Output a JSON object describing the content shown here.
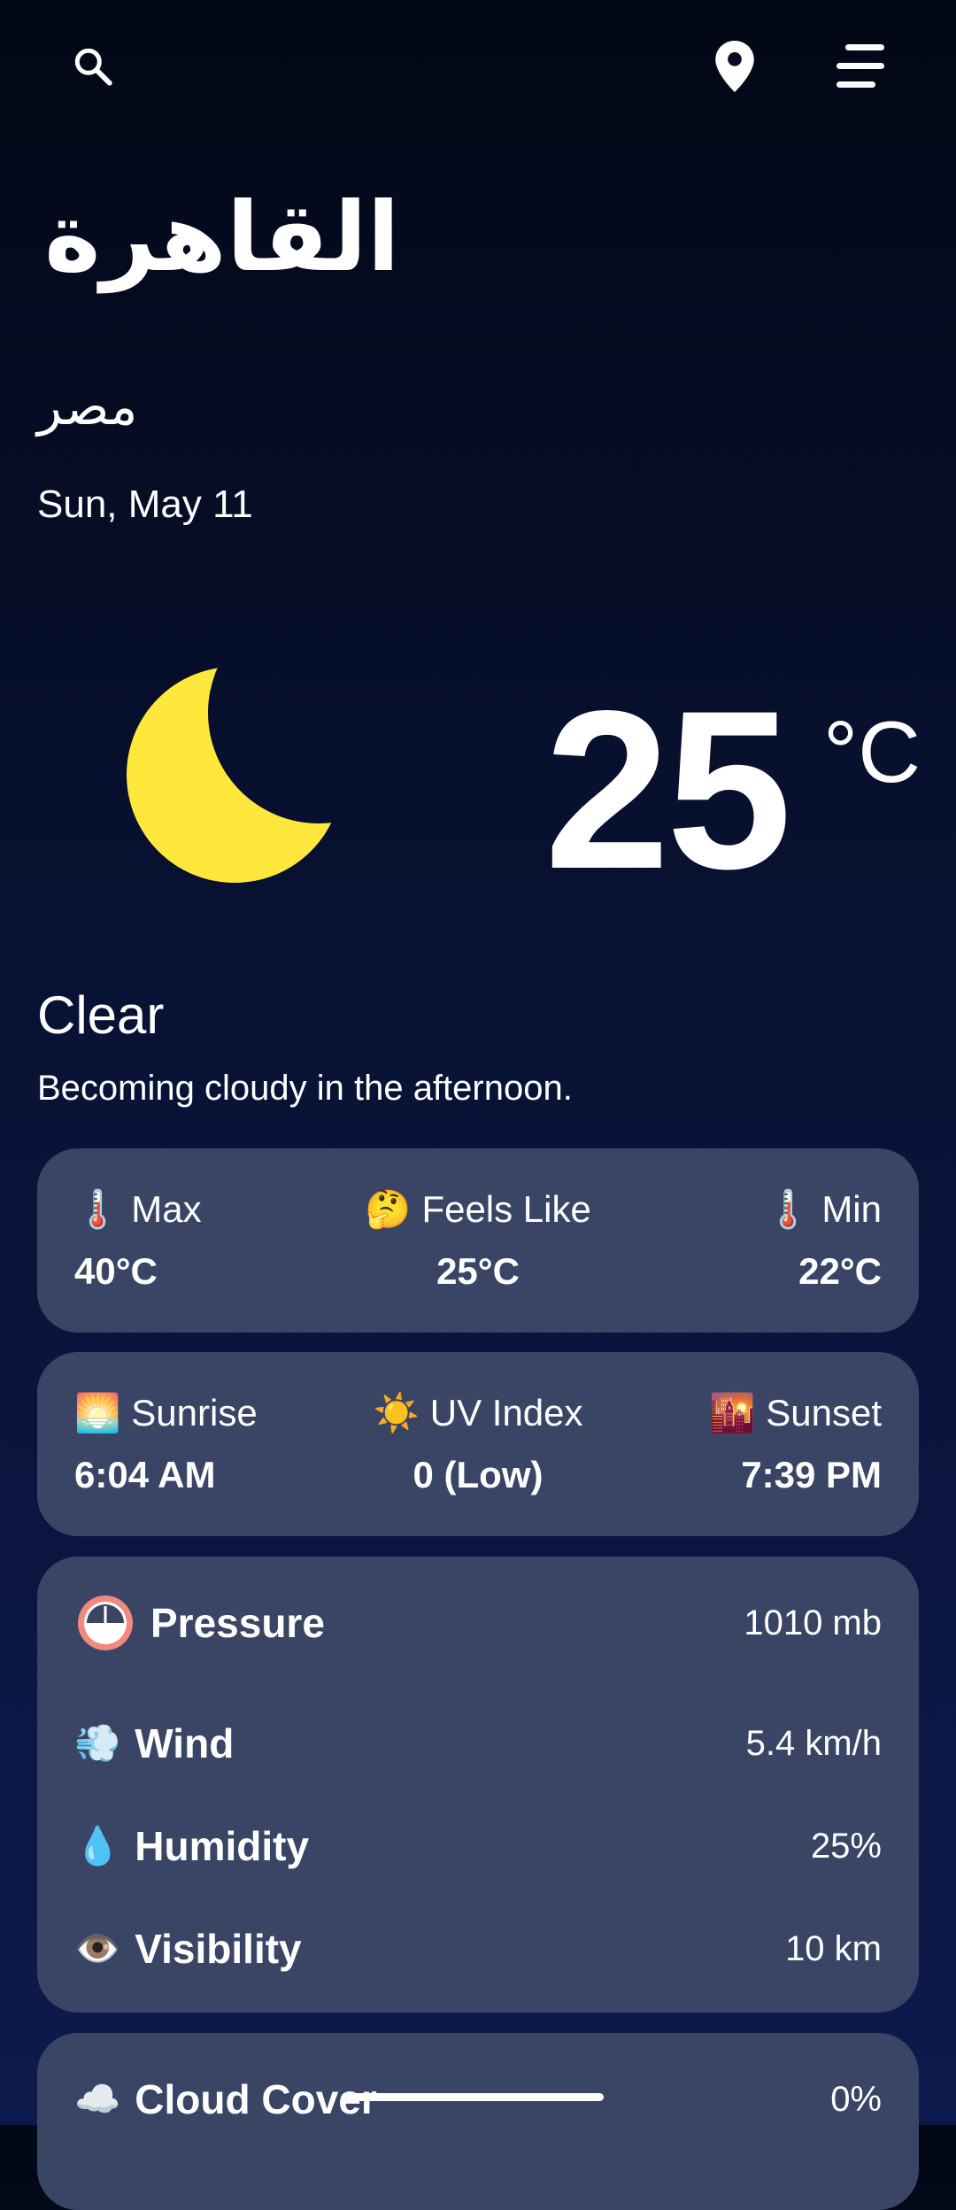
{
  "header": {
    "search_icon": "search-icon",
    "location_icon": "location-pin-icon",
    "menu_icon": "menu-icon"
  },
  "location": {
    "city": "القاهرة",
    "country": "مصر",
    "date": "Sun, May 11"
  },
  "current": {
    "icon": "moon-icon",
    "temperature": "25",
    "unit": "°C",
    "condition": "Clear",
    "description": "Becoming cloudy in the afternoon."
  },
  "temps_card": {
    "max_label": "Max",
    "max_value": "40°C",
    "feels_label": "Feels Like",
    "feels_value": "25°C",
    "min_label": "Min",
    "min_value": "22°C"
  },
  "sun_card": {
    "sunrise_label": "Sunrise",
    "sunrise_value": "6:04 AM",
    "uv_label": "UV Index",
    "uv_value": "0 (Low)",
    "sunset_label": "Sunset",
    "sunset_value": "7:39 PM"
  },
  "details_card": {
    "pressure_label": "Pressure",
    "pressure_value": "1010 mb",
    "wind_label": "Wind",
    "wind_value": "5.4 km/h",
    "humidity_label": "Humidity",
    "humidity_value": "25%",
    "visibility_label": "Visibility",
    "visibility_value": "10 km"
  },
  "cloud_card": {
    "cloud_label": "Cloud Cover",
    "cloud_value": "0%"
  },
  "colors": {
    "background_top": "#030816",
    "background_bottom": "#0c1a4d",
    "card": "#3a4566",
    "moon": "#ffe83b"
  }
}
